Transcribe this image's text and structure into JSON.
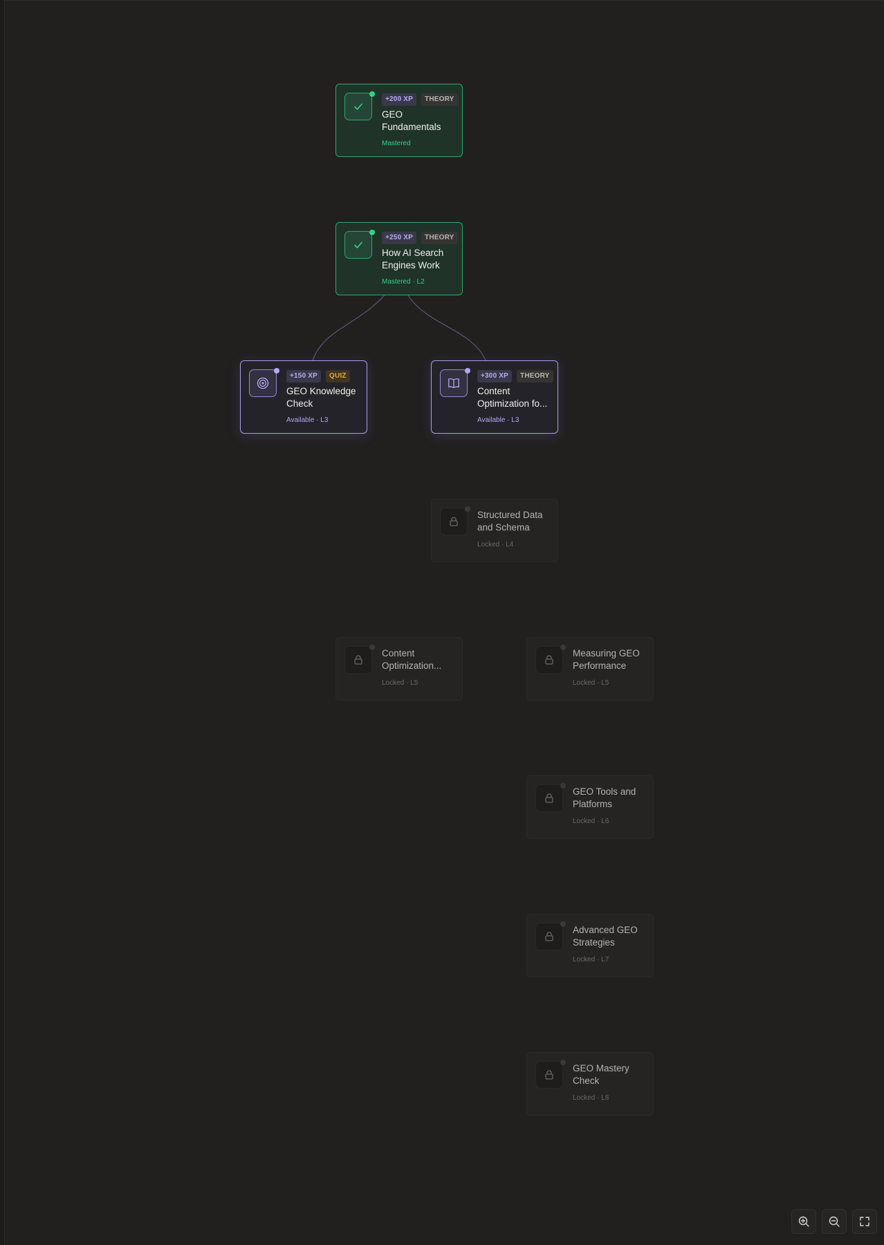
{
  "colors": {
    "mastered": "#35d188",
    "available": "#b3a8f5",
    "locked": "#6b6964",
    "quiz": "#e1a93f"
  },
  "nodes": [
    {
      "id": "geo-fundamentals",
      "state": "mastered",
      "icon": "check-icon",
      "xp": "+200 XP",
      "type": "THEORY",
      "title": "GEO Fundamentals",
      "status": "Mastered"
    },
    {
      "id": "how-ai-search",
      "state": "mastered",
      "icon": "check-icon",
      "xp": "+250 XP",
      "type": "THEORY",
      "title": "How AI Search Engines Work",
      "status": "Mastered · L2"
    },
    {
      "id": "geo-knowledge-check",
      "state": "available",
      "icon": "target-icon",
      "xp": "+150 XP",
      "type": "QUIZ",
      "title": "GEO Knowledge Check",
      "status": "Available · L3"
    },
    {
      "id": "content-optimization-1",
      "state": "available",
      "icon": "book-icon",
      "xp": "+300 XP",
      "type": "THEORY",
      "title": "Content Optimization fo...",
      "status": "Available · L3"
    },
    {
      "id": "structured-data",
      "state": "locked",
      "icon": "lock-icon",
      "title": "Structured Data and Schema",
      "status": "Locked · L4"
    },
    {
      "id": "content-optimization-2",
      "state": "locked",
      "icon": "lock-icon",
      "title": "Content Optimization...",
      "status": "Locked · L5"
    },
    {
      "id": "measuring-geo",
      "state": "locked",
      "icon": "lock-icon",
      "title": "Measuring GEO Performance",
      "status": "Locked · L5"
    },
    {
      "id": "geo-tools",
      "state": "locked",
      "icon": "lock-icon",
      "title": "GEO Tools and Platforms",
      "status": "Locked · L6"
    },
    {
      "id": "advanced-geo",
      "state": "locked",
      "icon": "lock-icon",
      "title": "Advanced GEO Strategies",
      "status": "Locked · L7"
    },
    {
      "id": "geo-mastery-check",
      "state": "locked",
      "icon": "lock-icon",
      "title": "GEO Mastery Check",
      "status": "Locked · L8"
    }
  ],
  "controls": [
    {
      "id": "zoom-in",
      "icon": "zoom-in-icon"
    },
    {
      "id": "zoom-out",
      "icon": "zoom-out-icon"
    },
    {
      "id": "fit-view",
      "icon": "fullscreen-icon"
    }
  ]
}
